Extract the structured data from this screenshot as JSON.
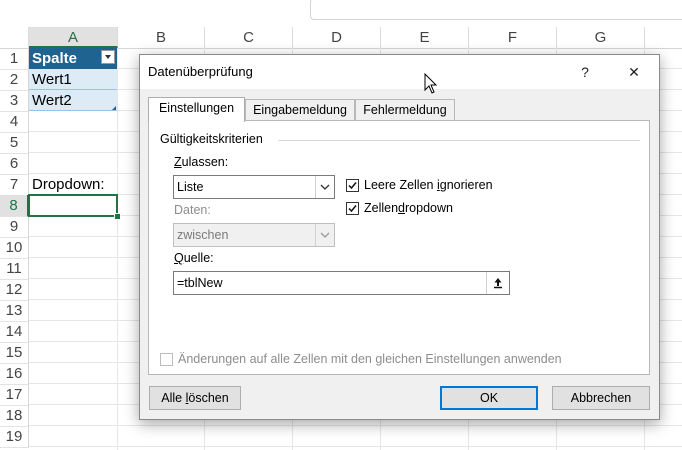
{
  "sheet": {
    "columns": [
      "A",
      "B",
      "C",
      "D",
      "E",
      "F",
      "G"
    ],
    "rows": [
      "1",
      "2",
      "3",
      "4",
      "5",
      "6",
      "7",
      "8",
      "9",
      "10",
      "11",
      "12",
      "13",
      "14",
      "15",
      "16",
      "17",
      "18",
      "19"
    ],
    "table_header": "Spalte",
    "table_rows": [
      "Wert1",
      "Wert2"
    ],
    "dropdown_label": "Dropdown:"
  },
  "dialog": {
    "title": "Datenüberprüfung",
    "help": "?",
    "close": "✕",
    "tabs": [
      "Einstellungen",
      "Eingabemeldung",
      "Fehlermeldung"
    ],
    "group_title": "Gültigkeitskriterien",
    "allow": {
      "label_pre": "",
      "label_u": "Z",
      "label_post": "ulassen:",
      "value": "Liste"
    },
    "data": {
      "label": "Daten:",
      "value": "zwischen"
    },
    "ignore_blank": {
      "pre": "Leere Zellen ",
      "u": "i",
      "post": "gnorieren",
      "checked": true
    },
    "in_cell_dropdown": {
      "pre": "Zellen",
      "u": "d",
      "post": "ropdown",
      "checked": true
    },
    "source": {
      "label_u": "Q",
      "label_post": "uelle:",
      "value": "=tblNew"
    },
    "apply_all": {
      "label": "Änderungen auf alle Zellen mit den gleichen Einstellungen anwenden",
      "checked": false
    },
    "buttons": {
      "clear_pre": "Alle ",
      "clear_u": "l",
      "clear_post": "öschen",
      "ok": "OK",
      "cancel": "Abbrechen"
    }
  }
}
